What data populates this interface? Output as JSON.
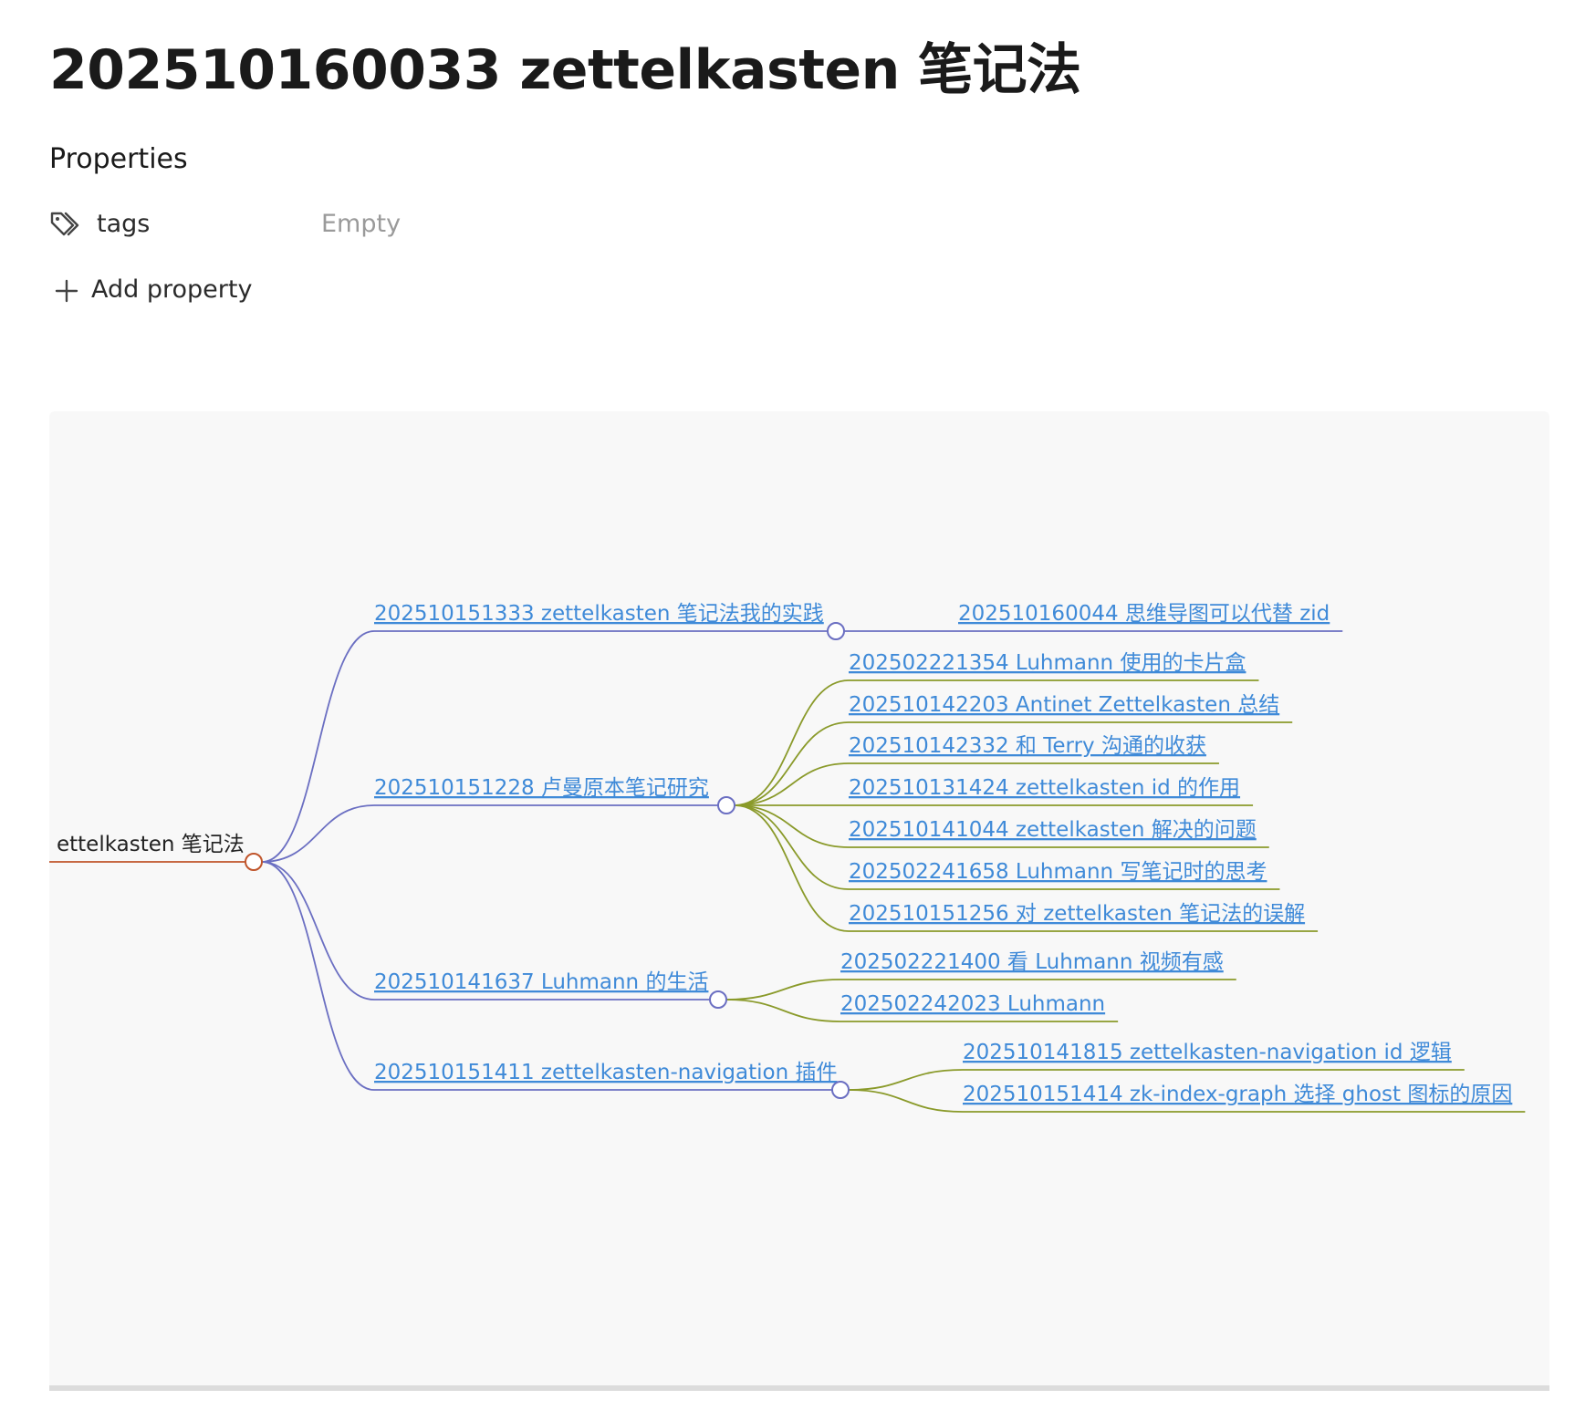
{
  "page": {
    "title": "202510160033 zettelkasten 笔记法"
  },
  "properties": {
    "heading": "Properties",
    "items": [
      {
        "icon": "tags-icon",
        "key": "tags",
        "value": "Empty"
      }
    ],
    "add_label": "Add property"
  },
  "mindmap": {
    "colors": {
      "root": "#c0552b",
      "level1": "#6b6fc2",
      "level2": "#8a9a2a",
      "link_text": "#3f8ad8",
      "panel_bg": "#f8f8f8"
    },
    "root": {
      "label": "ettelkasten 笔记法",
      "children": [
        {
          "label": "202510151333 zettelkasten 笔记法我的实践",
          "children": [
            {
              "label": "202510160044 思维导图可以代替 zid"
            }
          ]
        },
        {
          "label": "202510151228 卢曼原本笔记研究",
          "children": [
            {
              "label": "202502221354 Luhmann 使用的卡片盒"
            },
            {
              "label": "202510142203 Antinet Zettelkasten 总结"
            },
            {
              "label": "202510142332 和 Terry 沟通的收获"
            },
            {
              "label": "202510131424 zettelkasten id 的作用"
            },
            {
              "label": "202510141044 zettelkasten 解决的问题"
            },
            {
              "label": "202502241658 Luhmann 写笔记时的思考"
            },
            {
              "label": "202510151256 对 zettelkasten 笔记法的误解"
            }
          ]
        },
        {
          "label": "202510141637 Luhmann 的生活",
          "children": [
            {
              "label": "202502221400 看 Luhmann 视频有感"
            },
            {
              "label": "202502242023 Luhmann"
            }
          ]
        },
        {
          "label": "202510151411 zettelkasten-navigation 插件",
          "children": [
            {
              "label": "202510141815 zettelkasten-navigation id 逻辑"
            },
            {
              "label": "202510151414 zk-index-graph 选择 ghost 图标的原因"
            }
          ]
        }
      ]
    }
  }
}
